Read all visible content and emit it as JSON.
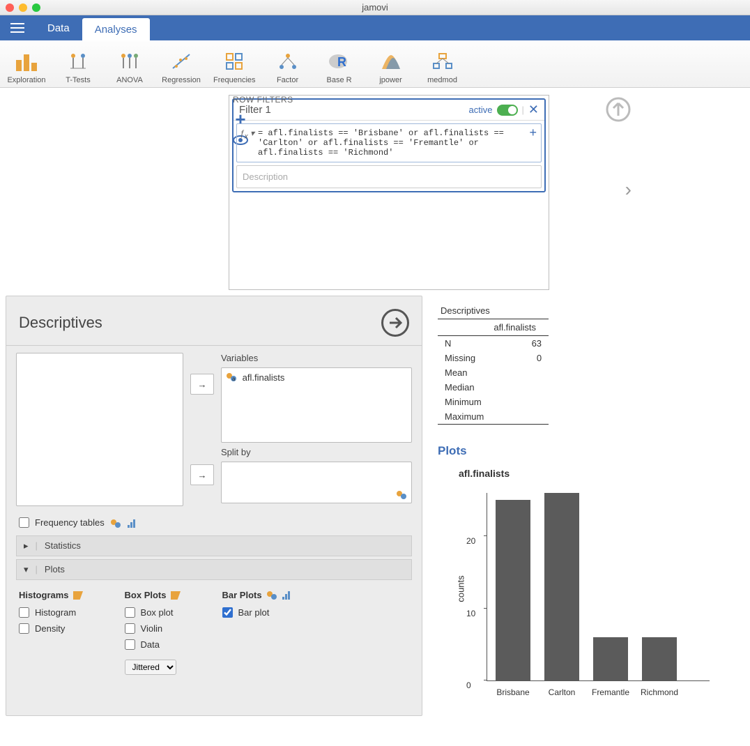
{
  "app": {
    "title": "jamovi"
  },
  "tabs": {
    "data": "Data",
    "analyses": "Analyses"
  },
  "ribbon": [
    {
      "id": "exploration",
      "label": "Exploration"
    },
    {
      "id": "ttests",
      "label": "T-Tests"
    },
    {
      "id": "anova",
      "label": "ANOVA"
    },
    {
      "id": "regression",
      "label": "Regression"
    },
    {
      "id": "frequencies",
      "label": "Frequencies"
    },
    {
      "id": "factor",
      "label": "Factor"
    },
    {
      "id": "baser",
      "label": "Base R"
    },
    {
      "id": "jpower",
      "label": "jpower"
    },
    {
      "id": "medmod",
      "label": "medmod"
    }
  ],
  "filters": {
    "heading": "ROW FILTERS",
    "filter1": {
      "title": "Filter 1",
      "active_label": "active",
      "expr": "= afl.finalists == 'Brisbane' or afl.finalists == 'Carlton' or afl.finalists == 'Fremantle' or afl.finalists == 'Richmond'",
      "desc_placeholder": "Description"
    }
  },
  "descriptives": {
    "title": "Descriptives",
    "variables_label": "Variables",
    "splitby_label": "Split by",
    "variable_item": "afl.finalists",
    "freq_label": "Frequency tables",
    "statistics_section": "Statistics",
    "plots_section": "Plots",
    "histograms_heading": "Histograms",
    "boxplots_heading": "Box Plots",
    "barplots_heading": "Bar Plots",
    "opt_histogram": "Histogram",
    "opt_density": "Density",
    "opt_boxplot": "Box plot",
    "opt_violin": "Violin",
    "opt_data": "Data",
    "opt_barplot": "Bar plot",
    "jitter_sel": "Jittered"
  },
  "results": {
    "table_title": "Descriptives",
    "colhead": "afl.finalists",
    "rows": [
      {
        "label": "N",
        "val": "63"
      },
      {
        "label": "Missing",
        "val": "0"
      },
      {
        "label": "Mean",
        "val": ""
      },
      {
        "label": "Median",
        "val": ""
      },
      {
        "label": "Minimum",
        "val": ""
      },
      {
        "label": "Maximum",
        "val": ""
      }
    ],
    "plots_heading": "Plots",
    "chart_title": "afl.finalists",
    "ylabel": "counts"
  },
  "chart_data": {
    "type": "bar",
    "categories": [
      "Brisbane",
      "Carlton",
      "Fremantle",
      "Richmond"
    ],
    "values": [
      25,
      26,
      6,
      6
    ],
    "ylabel": "counts",
    "ylim": [
      0,
      26
    ],
    "yticks": [
      0,
      10,
      20
    ]
  }
}
